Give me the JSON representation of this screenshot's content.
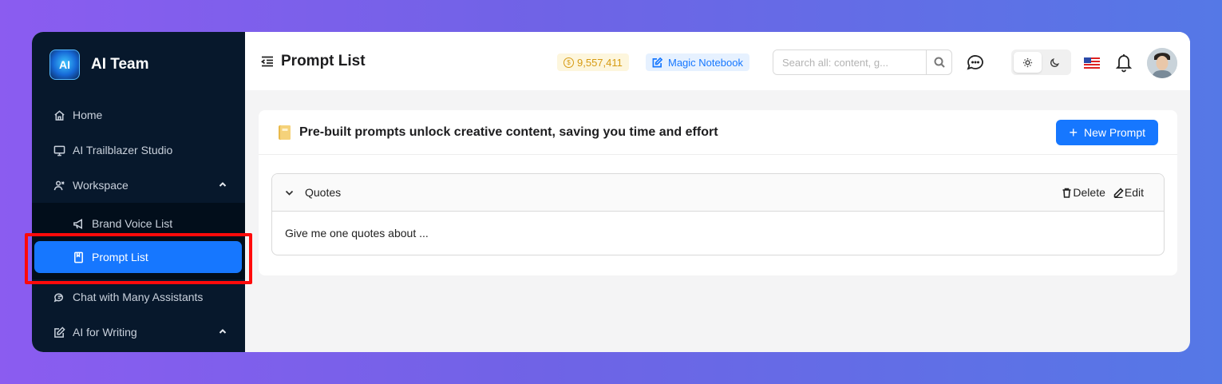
{
  "app": {
    "name": "AI Team",
    "logo_text": "AI"
  },
  "sidebar": {
    "items": [
      {
        "label": "Home",
        "icon": "home-icon"
      },
      {
        "label": "AI Trailblazer Studio",
        "icon": "monitor-icon"
      },
      {
        "label": "Workspace",
        "icon": "workspace-icon",
        "expanded": true,
        "children": [
          {
            "label": "Brand Voice List",
            "icon": "megaphone-icon"
          },
          {
            "label": "Prompt List",
            "icon": "book-icon",
            "active": true
          }
        ]
      },
      {
        "label": "Chat with Many Assistants",
        "icon": "chat-bubbles-icon"
      },
      {
        "label": "AI for Writing",
        "icon": "edit-icon",
        "expanded": true
      }
    ]
  },
  "header": {
    "title": "Prompt List",
    "credits": "9,557,411",
    "notebook_label": "Magic Notebook",
    "search_placeholder": "Search all: content, g..."
  },
  "main": {
    "card_title": "Pre-built prompts unlock creative content, saving you time and effort",
    "new_button_label": "New Prompt",
    "prompts": [
      {
        "title": "Quotes",
        "body": "Give me one quotes about ...",
        "delete_label": "Delete",
        "edit_label": "Edit"
      }
    ]
  },
  "colors": {
    "accent": "#1677ff",
    "sidebar_bg": "#07182c",
    "highlight": "#ff0a0a"
  }
}
